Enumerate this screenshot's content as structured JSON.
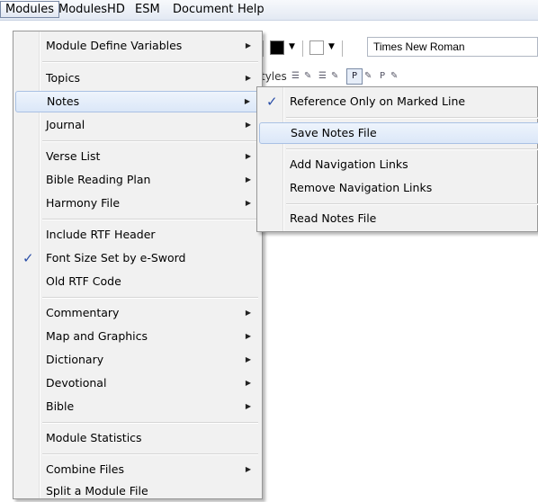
{
  "menubar": {
    "items": [
      "Modules",
      "ModulesHD",
      "ESM",
      "Document",
      "Help"
    ]
  },
  "toolbar": {
    "font_name": "Times New Roman",
    "styles_label": "tyles"
  },
  "modules_menu": {
    "items": [
      {
        "label": "Module Define Variables",
        "submenu": true,
        "checked": false
      },
      {
        "label": "Topics",
        "submenu": true,
        "checked": false
      },
      {
        "label": "Notes",
        "submenu": true,
        "checked": false,
        "highlighted": true
      },
      {
        "label": "Journal",
        "submenu": true,
        "checked": false
      },
      {
        "label": "Verse List",
        "submenu": true,
        "checked": false
      },
      {
        "label": "Bible Reading Plan",
        "submenu": true,
        "checked": false
      },
      {
        "label": "Harmony File",
        "submenu": true,
        "checked": false
      },
      {
        "label": "Include RTF Header",
        "submenu": false,
        "checked": false
      },
      {
        "label": "Font Size Set by e-Sword",
        "submenu": false,
        "checked": true
      },
      {
        "label": "Old RTF Code",
        "submenu": false,
        "checked": false
      },
      {
        "label": "Commentary",
        "submenu": true,
        "checked": false
      },
      {
        "label": "Map and Graphics",
        "submenu": true,
        "checked": false
      },
      {
        "label": "Dictionary",
        "submenu": true,
        "checked": false
      },
      {
        "label": "Devotional",
        "submenu": true,
        "checked": false
      },
      {
        "label": "Bible",
        "submenu": true,
        "checked": false
      },
      {
        "label": "Module Statistics",
        "submenu": false,
        "checked": false
      },
      {
        "label": "Combine Files",
        "submenu": true,
        "checked": false
      },
      {
        "label": "Split a Module File",
        "submenu": false,
        "checked": false
      }
    ]
  },
  "notes_submenu": {
    "items": [
      {
        "label": "Reference Only on Marked Line",
        "checked": true
      },
      {
        "label": "Save Notes File",
        "checked": false,
        "highlighted": true
      },
      {
        "label": "Add Navigation Links",
        "checked": false
      },
      {
        "label": "Remove Navigation Links",
        "checked": false
      },
      {
        "label": "Read Notes File",
        "checked": false
      }
    ]
  },
  "icons": {
    "check": "checkmark-icon",
    "submenu_arrow": "submenu-arrow-icon",
    "dropdown": "dropdown-arrow-icon"
  },
  "colors": {
    "menu_bg": "#f1f1f1",
    "highlight": "#dbe7f8",
    "check": "#2b4fa8"
  }
}
